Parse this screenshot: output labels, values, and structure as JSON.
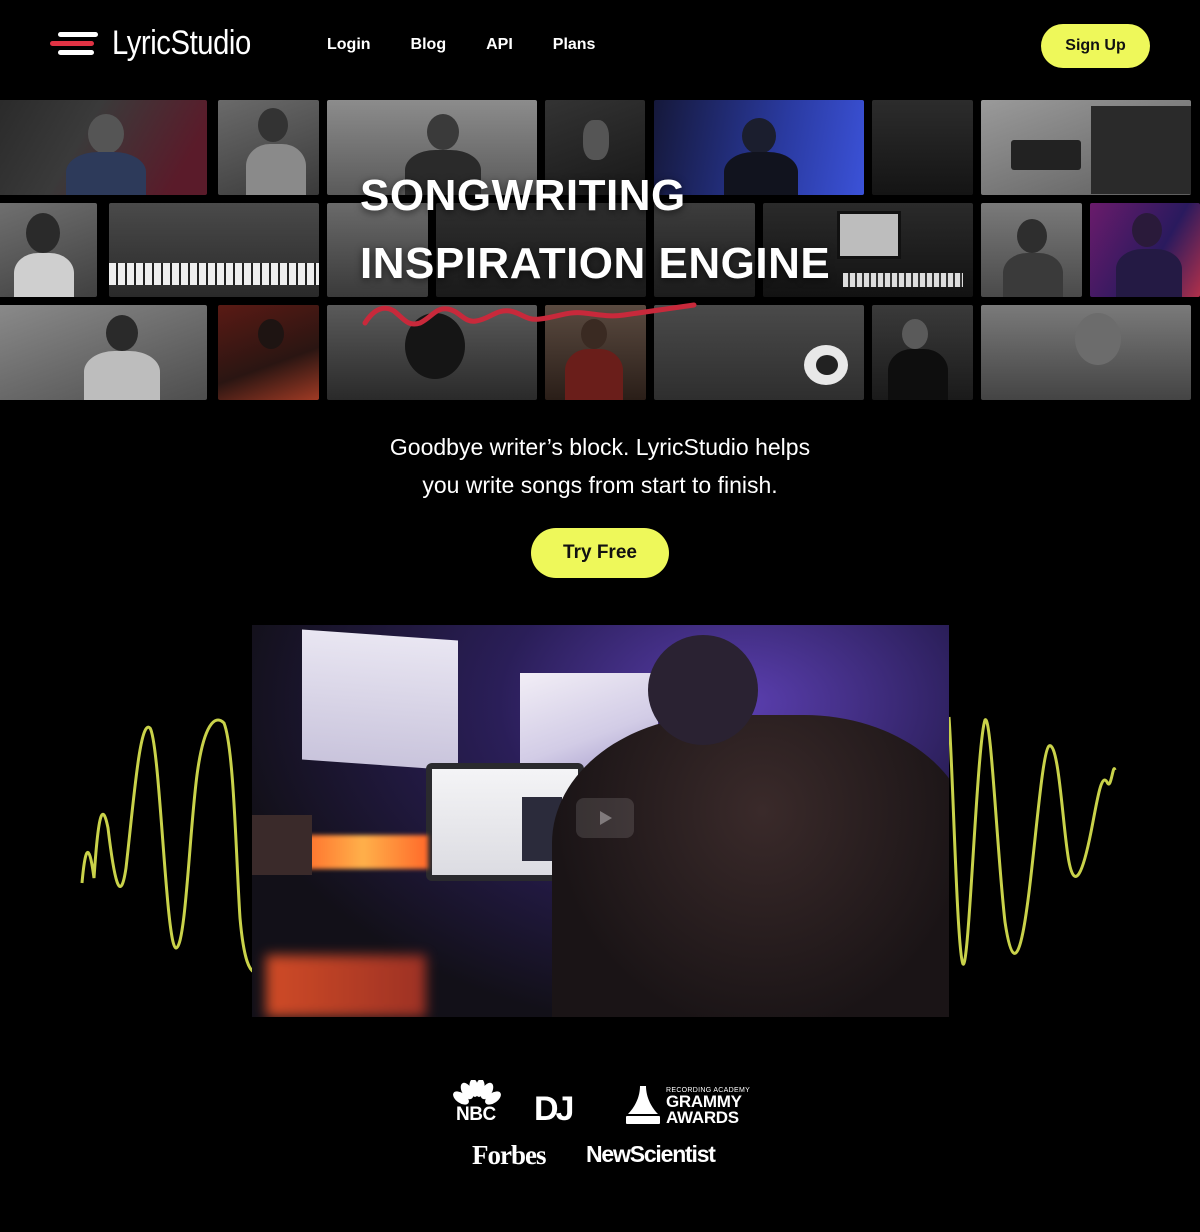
{
  "brand": {
    "name": "LyricStudio",
    "accent_red": "#e03344",
    "accent_yellow": "#eef85a"
  },
  "nav": {
    "login": "Login",
    "blog": "Blog",
    "api": "API",
    "plans": "Plans"
  },
  "header": {
    "signup_label": "Sign Up"
  },
  "hero": {
    "title_line1": "SONGWRITING",
    "title_line2": "INSPIRATION ENGINE",
    "subtitle_line1": "Goodbye writer’s block. LyricStudio helps",
    "subtitle_line2": "you write songs from start to finish.",
    "cta_label": "Try Free"
  },
  "video": {
    "play_icon": "play-icon"
  },
  "press": {
    "nbc": "NBC",
    "dj": "DJ",
    "grammy_small": "RECORDING ACADEMY",
    "grammy_line1": "GRAMMY",
    "grammy_line2": "AWARDS",
    "forbes": "Forbes",
    "newscientist": "NewScientist"
  }
}
